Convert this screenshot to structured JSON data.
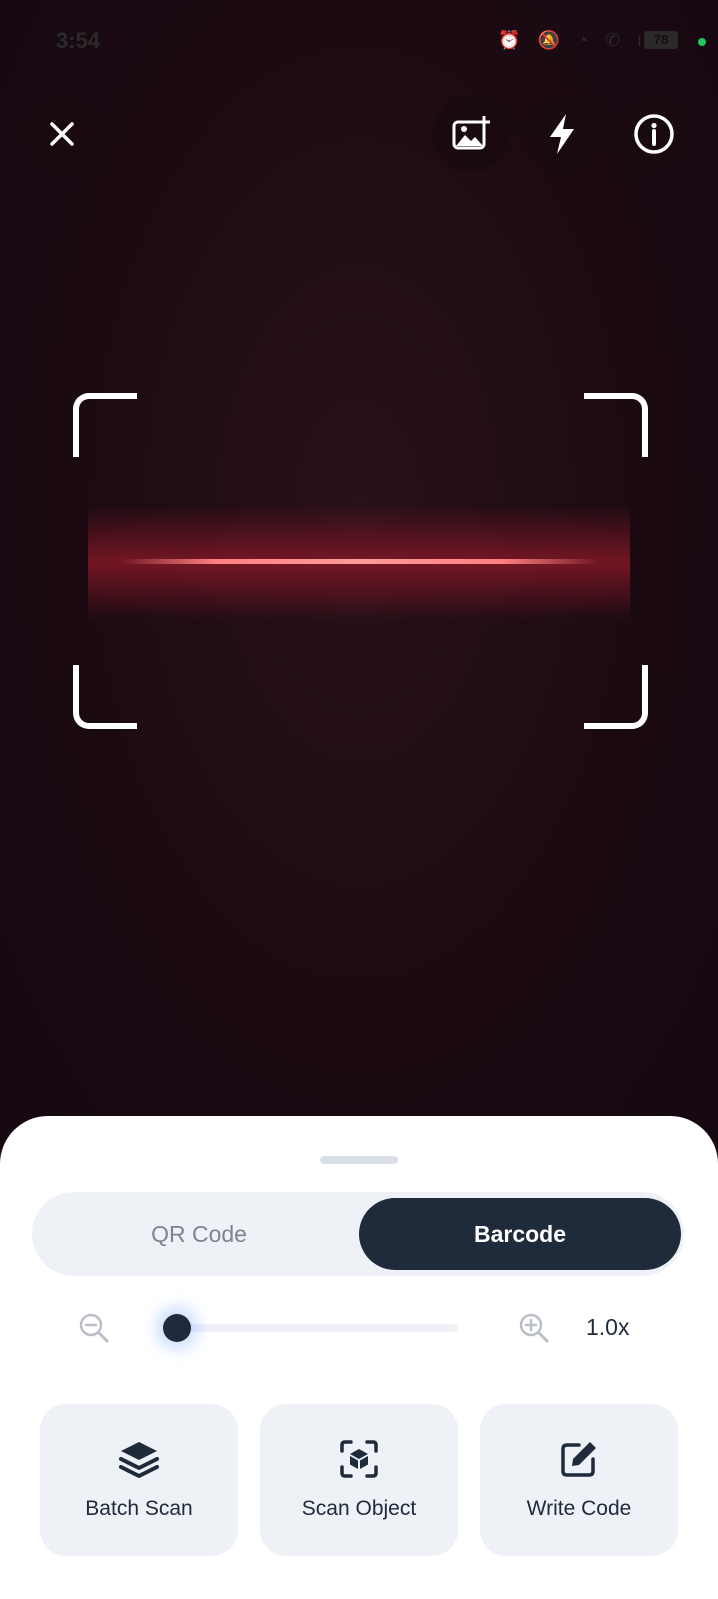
{
  "status_bar": {
    "time": "3:54",
    "icons_text": "⏰ 🔕 ◔ ✆ ıl",
    "battery": "78",
    "dot_color": "#22c55e"
  },
  "top_controls": {
    "close_icon": "close-icon",
    "gallery_icon": "image-add-icon",
    "flash_icon": "flash-icon",
    "info_icon": "info-icon"
  },
  "scanner": {
    "laser_color": "#ff8a8a"
  },
  "sheet": {
    "modes": {
      "qr_label": "QR Code",
      "barcode_label": "Barcode",
      "selected": "Barcode"
    },
    "zoom": {
      "value_label": "1.0x",
      "slider_fraction": 0
    },
    "actions": [
      {
        "label": "Batch Scan",
        "icon": "layers-icon"
      },
      {
        "label": "Scan Object",
        "icon": "scan-cube-icon"
      },
      {
        "label": "Write Code",
        "icon": "edit-icon"
      }
    ]
  },
  "colors": {
    "accent_dark": "#1f2a3a",
    "chip_bg": "#eef1f6"
  }
}
